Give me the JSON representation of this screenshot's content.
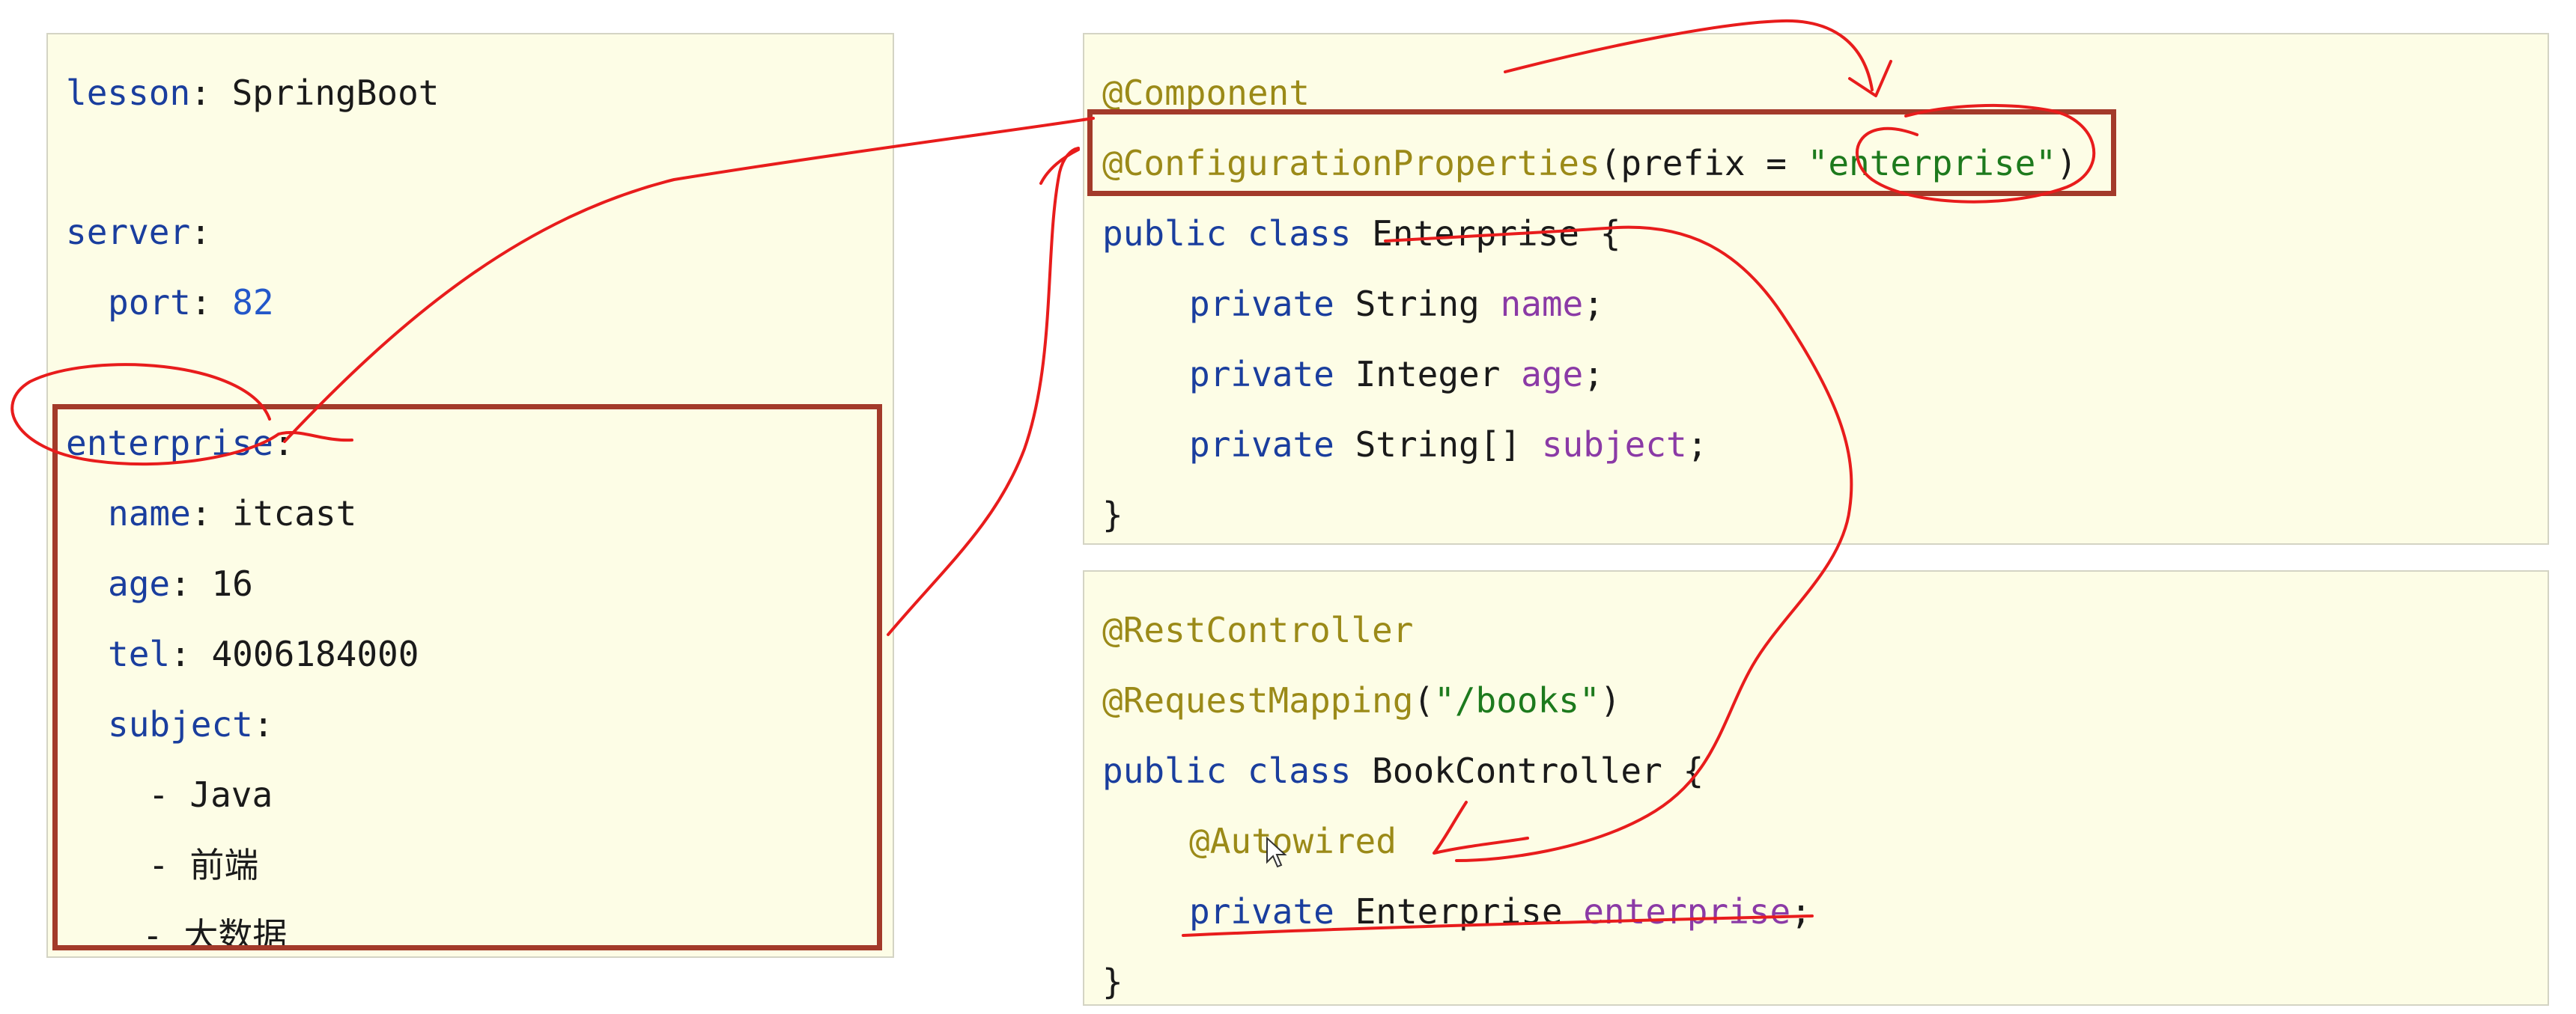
{
  "yaml": {
    "lesson_key": "lesson",
    "lesson_value": "SpringBoot",
    "server_key": "server",
    "port_key": "port",
    "port_value": "82",
    "enterprise_key": "enterprise",
    "name_key": "name",
    "name_value": "itcast",
    "age_key": "age",
    "age_value": "16",
    "tel_key": "tel",
    "tel_value": "4006184000",
    "subject_key": "subject",
    "subject_items": [
      "Java",
      "前端",
      "大数据"
    ]
  },
  "entity": {
    "ann_component": "@Component",
    "ann_config": "@ConfigurationProperties",
    "config_arg_key": "prefix = ",
    "config_arg_value": "\"enterprise\"",
    "kw_public": "public",
    "kw_class": "class",
    "class_name": "Enterprise",
    "kw_private": "private",
    "fields": [
      {
        "type": "String",
        "name": "name"
      },
      {
        "type": "Integer",
        "name": "age"
      },
      {
        "type": "String[]",
        "name": "subject"
      }
    ]
  },
  "controller": {
    "ann_rest": "@RestController",
    "ann_mapping": "@RequestMapping",
    "mapping_value": "\"/books\"",
    "class_name": "BookController",
    "ann_autowired": "@Autowired",
    "field_type": "Enterprise",
    "field_name": "enterprise"
  },
  "colors": {
    "panel_bg": "#fdfde6",
    "highlight_box": "#a33a2a",
    "ink": "#e81c1c"
  }
}
